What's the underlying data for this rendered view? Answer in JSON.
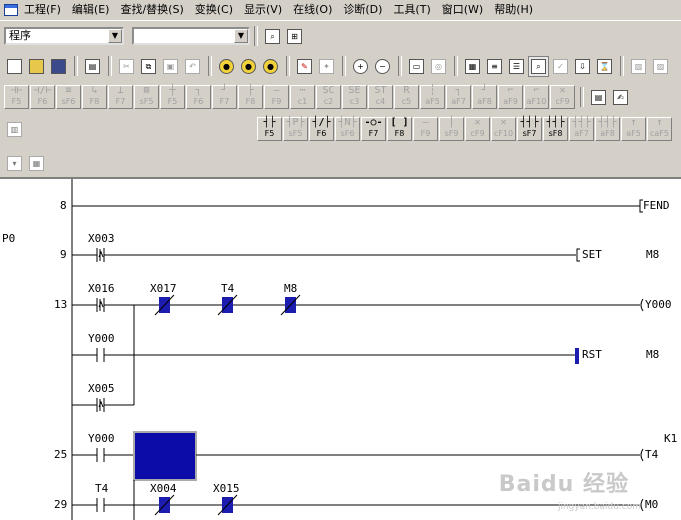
{
  "menu": [
    {
      "label": "工程(F)"
    },
    {
      "label": "编辑(E)"
    },
    {
      "label": "查找/替换(S)"
    },
    {
      "label": "变换(C)"
    },
    {
      "label": "显示(V)"
    },
    {
      "label": "在线(O)"
    },
    {
      "label": "诊断(D)"
    },
    {
      "label": "工具(T)"
    },
    {
      "label": "窗口(W)"
    },
    {
      "label": "帮助(H)"
    }
  ],
  "toolbar1": {
    "program_combo_value": "程序",
    "second_combo_value": ""
  },
  "fkeys_row1": [
    {
      "label": "F5",
      "sym": "⊣⊢"
    },
    {
      "label": "F6",
      "sym": "⊣/⊢"
    },
    {
      "label": "sF6",
      "sym": "≡"
    },
    {
      "label": "F8",
      "sym": "↳"
    },
    {
      "label": "F7",
      "sym": "⊥"
    },
    {
      "label": "sF5",
      "sym": "⊠"
    },
    {
      "label": "F5",
      "sym": "┼"
    },
    {
      "label": "F6",
      "sym": "┐"
    },
    {
      "label": "F7",
      "sym": "┘"
    },
    {
      "label": "F8",
      "sym": "├"
    },
    {
      "label": "F9",
      "sym": "—"
    },
    {
      "label": "c1",
      "sym": "⋯"
    },
    {
      "label": "c2",
      "sym": "SC"
    },
    {
      "label": "c3",
      "sym": "SE"
    },
    {
      "label": "c4",
      "sym": "ST"
    },
    {
      "label": "c5",
      "sym": "R"
    },
    {
      "label": "aF5",
      "sym": "┆"
    },
    {
      "label": "aF7",
      "sym": "┐"
    },
    {
      "label": "aF8",
      "sym": "┘"
    },
    {
      "label": "aF9",
      "sym": "⌐"
    },
    {
      "label": "aF10",
      "sym": "⌐"
    },
    {
      "label": "cF9",
      "sym": "✕"
    }
  ],
  "fkeys_row2": [
    {
      "label": "F5",
      "sym": "┤├",
      "active": true
    },
    {
      "label": "sF5",
      "sym": "┤P├",
      "active": false
    },
    {
      "label": "F6",
      "sym": "┤/├",
      "active": true
    },
    {
      "label": "sF6",
      "sym": "┤N├",
      "active": false
    },
    {
      "label": "F7",
      "sym": "-○-",
      "active": true
    },
    {
      "label": "F8",
      "sym": "[ ]",
      "active": true
    },
    {
      "label": "F9",
      "sym": "—",
      "active": false
    },
    {
      "label": "sF9",
      "sym": "│",
      "active": false
    },
    {
      "label": "cF9",
      "sym": "✕",
      "active": false
    },
    {
      "label": "cF10",
      "sym": "✕",
      "active": false
    },
    {
      "label": "sF7",
      "sym": "┤┤├",
      "active": true
    },
    {
      "label": "sF8",
      "sym": "┤┤├",
      "active": true
    },
    {
      "label": "aF7",
      "sym": "┤┤├",
      "active": false
    },
    {
      "label": "aF8",
      "sym": "┤┤├",
      "active": false
    },
    {
      "label": "aF5",
      "sym": "↑",
      "active": false
    },
    {
      "label": "caF5",
      "sym": "↑",
      "active": false
    }
  ],
  "ladder": {
    "step_8": "8",
    "fend": "FEND",
    "pointer": "P0",
    "step_9": "9",
    "x003": "X003",
    "set_label": "SET",
    "set_device": "M8",
    "step_13": "13",
    "x016": "X016",
    "x017": "X017",
    "t4_a": "T4",
    "m8_contact": "M8",
    "y000_coil": "Y000",
    "y000_contact": "Y000",
    "rst_label": "RST",
    "rst_device": "M8",
    "x005": "X005",
    "step_25": "25",
    "y000_contact2": "Y000",
    "k1": "K1",
    "t4_coil": "T4",
    "step_29": "29",
    "t4_b": "T4",
    "x004": "X004",
    "x015": "X015",
    "m0_coil": "M0",
    "watermark": "Baidu 经验",
    "watermark_sub": "jingyan.baidu.com"
  }
}
